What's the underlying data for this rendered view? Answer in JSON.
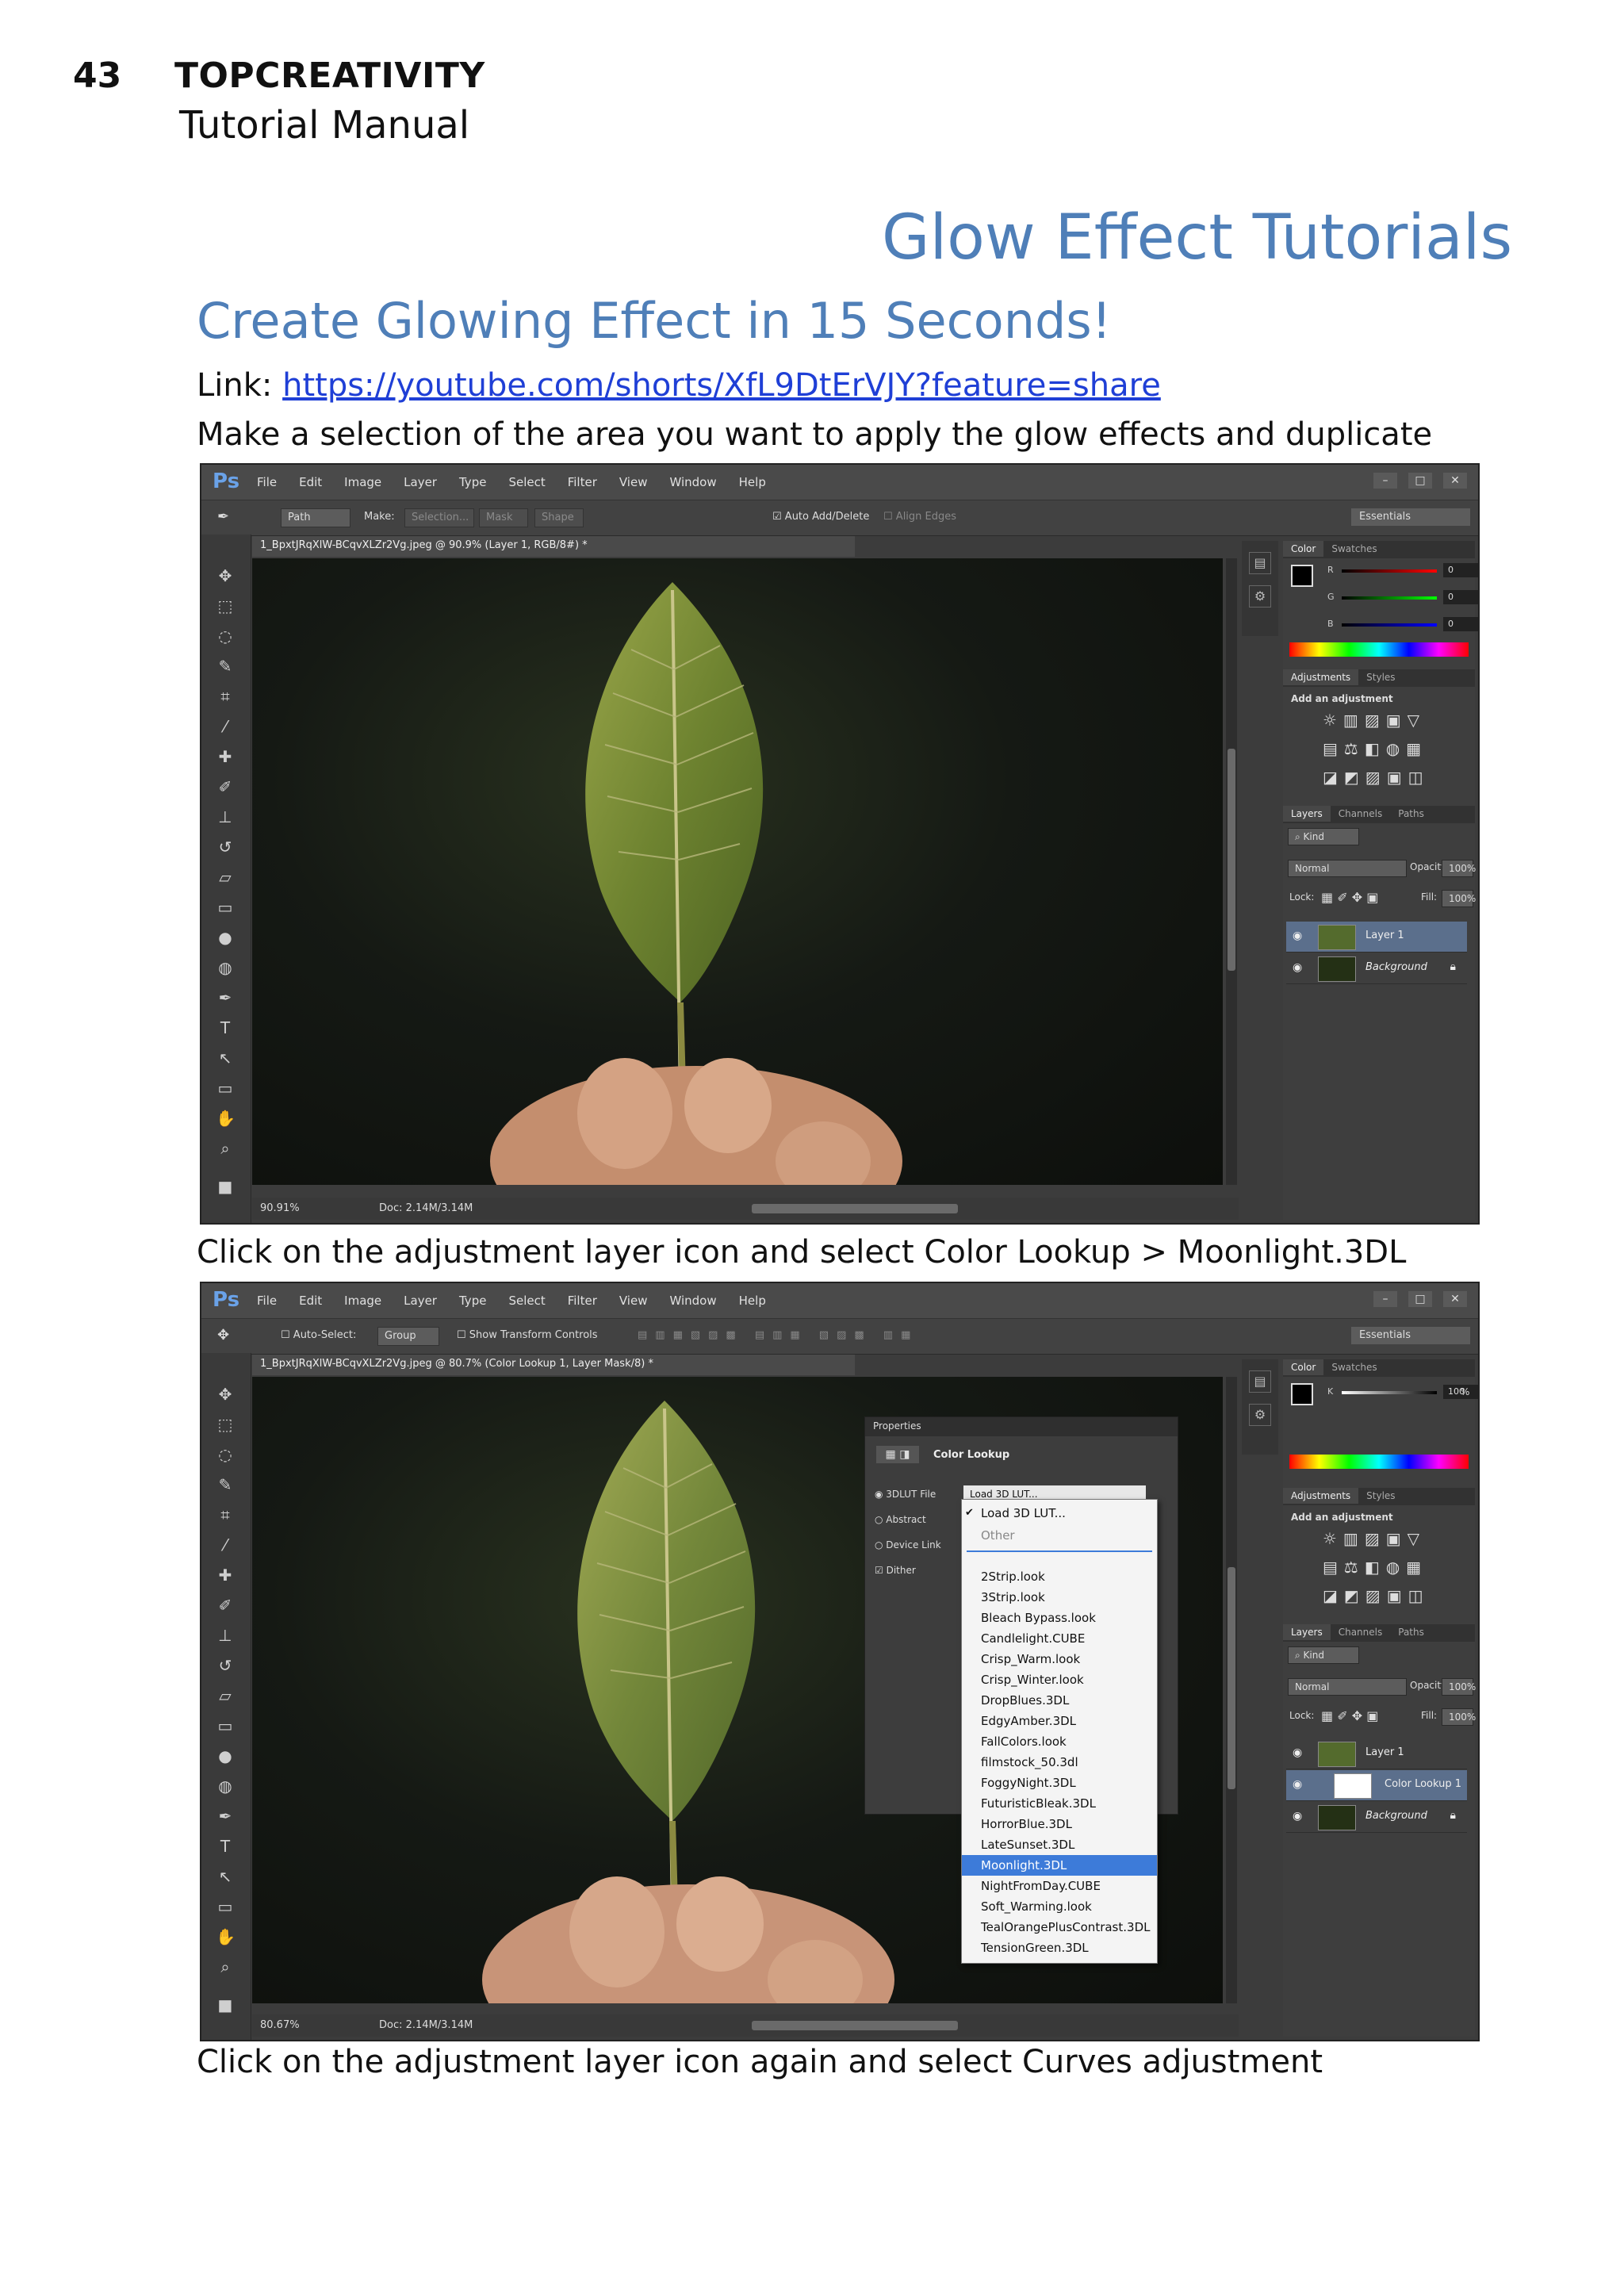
{
  "header": {
    "page_number": "43",
    "brand": "TOPCREATIVITY",
    "subtitle": "Tutorial Manual"
  },
  "title": "Glow Effect Tutorials",
  "section_title": "Create Glowing Effect in 15 Seconds!",
  "link": {
    "label": "Link:",
    "url": "https://youtube.com/shorts/XfL9DtErVJY?feature=share"
  },
  "steps": [
    "Make a selection of the area you want to apply the glow effects and duplicate",
    "Click on the adjustment layer icon and select Color Lookup > Moonlight.3DL",
    "Click on the adjustment layer icon again and select Curves adjustment"
  ],
  "colors": {
    "heading": "#4f7fb8",
    "link": "#1f3fd6",
    "selection": "#3d7bd9"
  },
  "photoshop": {
    "logo": "Ps",
    "menus": [
      "File",
      "Edit",
      "Image",
      "Layer",
      "Type",
      "Select",
      "Filter",
      "View",
      "Window",
      "Help"
    ],
    "window_controls": [
      "–",
      "□",
      "✕"
    ],
    "shot1": {
      "options": {
        "tool_mode": "Path",
        "make_label": "Make:",
        "buttons": [
          "Selection...",
          "Mask",
          "Shape"
        ],
        "auto_add_delete": "Auto Add/Delete",
        "align_edges": "Align Edges",
        "workspace": "Essentials"
      },
      "doc_tab": "1_BpxtJRqXlW-BCqvXLZr2Vg.jpeg @ 90.9% (Layer 1, RGB/8#) *",
      "status_zoom": "90.91%",
      "status_doc": "Doc: 2.14M/3.14M",
      "color_tabs": [
        "Color",
        "Swatches"
      ],
      "rgb": [
        {
          "channel": "R",
          "value": "0"
        },
        {
          "channel": "G",
          "value": "0"
        },
        {
          "channel": "B",
          "value": "0"
        }
      ],
      "adj_tabs": [
        "Adjustments",
        "Styles"
      ],
      "add_adjustment": "Add an adjustment",
      "layer_tabs": [
        "Layers",
        "Channels",
        "Paths"
      ],
      "kind": "Kind",
      "blend": "Normal",
      "opacity_label": "Opacity:",
      "opacity": "100%",
      "lock_label": "Lock:",
      "fill_label": "Fill:",
      "fill": "100%",
      "layers": [
        "Layer 1",
        "Background"
      ]
    },
    "shot2": {
      "options": {
        "auto_select": "Auto-Select:",
        "group": "Group",
        "show_transform": "Show Transform Controls",
        "workspace": "Essentials"
      },
      "doc_tab": "1_BpxtJRqXlW-BCqvXLZr2Vg.jpeg @ 80.7% (Color Lookup 1, Layer Mask/8) *",
      "status_zoom": "80.67%",
      "status_doc": "Doc: 2.14M/3.14M",
      "k_label": "K",
      "k_value": "100",
      "k_unit": "%",
      "properties": {
        "header": "Properties",
        "title": "Color Lookup",
        "options": [
          "3DLUT File",
          "Abstract",
          "Device Link",
          "Dither"
        ],
        "lut_field": "Load 3D LUT..."
      },
      "dropdown": {
        "checked": "Load 3D LUT...",
        "other": "Other",
        "items": [
          "2Strip.look",
          "3Strip.look",
          "Bleach Bypass.look",
          "Candlelight.CUBE",
          "Crisp_Warm.look",
          "Crisp_Winter.look",
          "DropBlues.3DL",
          "EdgyAmber.3DL",
          "FallColors.look",
          "filmstock_50.3dl",
          "FoggyNight.3DL",
          "FuturisticBleak.3DL",
          "HorrorBlue.3DL",
          "LateSunset.3DL",
          "Moonlight.3DL",
          "NightFromDay.CUBE",
          "Soft_Warming.look",
          "TealOrangePlusContrast.3DL",
          "TensionGreen.3DL"
        ],
        "selected": "Moonlight.3DL"
      },
      "layers": [
        "Layer 1",
        "Color Lookup 1",
        "Background"
      ]
    }
  }
}
